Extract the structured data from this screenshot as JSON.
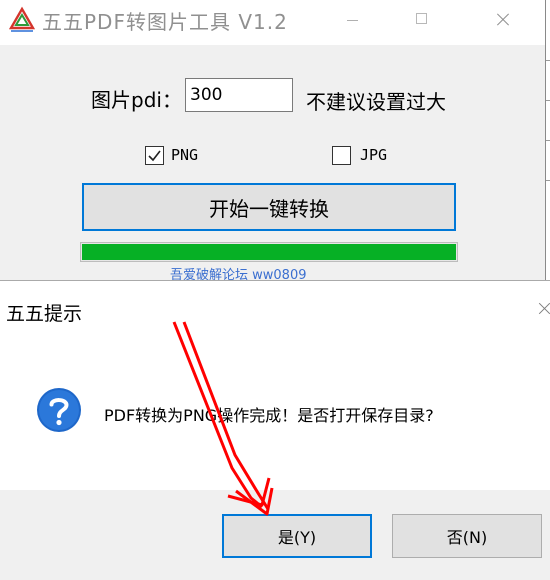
{
  "main_window": {
    "title": "五五PDF转图片工具   V1.2",
    "dpi_label": "图片pdi：",
    "dpi_value": "300",
    "dpi_hint": "不建议设置过大",
    "options": [
      {
        "label": "PNG",
        "checked": true
      },
      {
        "label": "JPG",
        "checked": false
      }
    ],
    "convert_button": "开始一键转换",
    "progress": 1.0,
    "progress_color": "#06b025",
    "credit_link": "吾爱破解论坛   ww0809"
  },
  "dialog": {
    "title": "五五提示",
    "icon": "question-icon",
    "message": "PDF转换为PNG操作完成！是否打开保存目录?",
    "yes_button": "是(Y)",
    "no_button": "否(N)"
  },
  "colors": {
    "accent": "#0078d7",
    "annotation": "#ff0000"
  }
}
